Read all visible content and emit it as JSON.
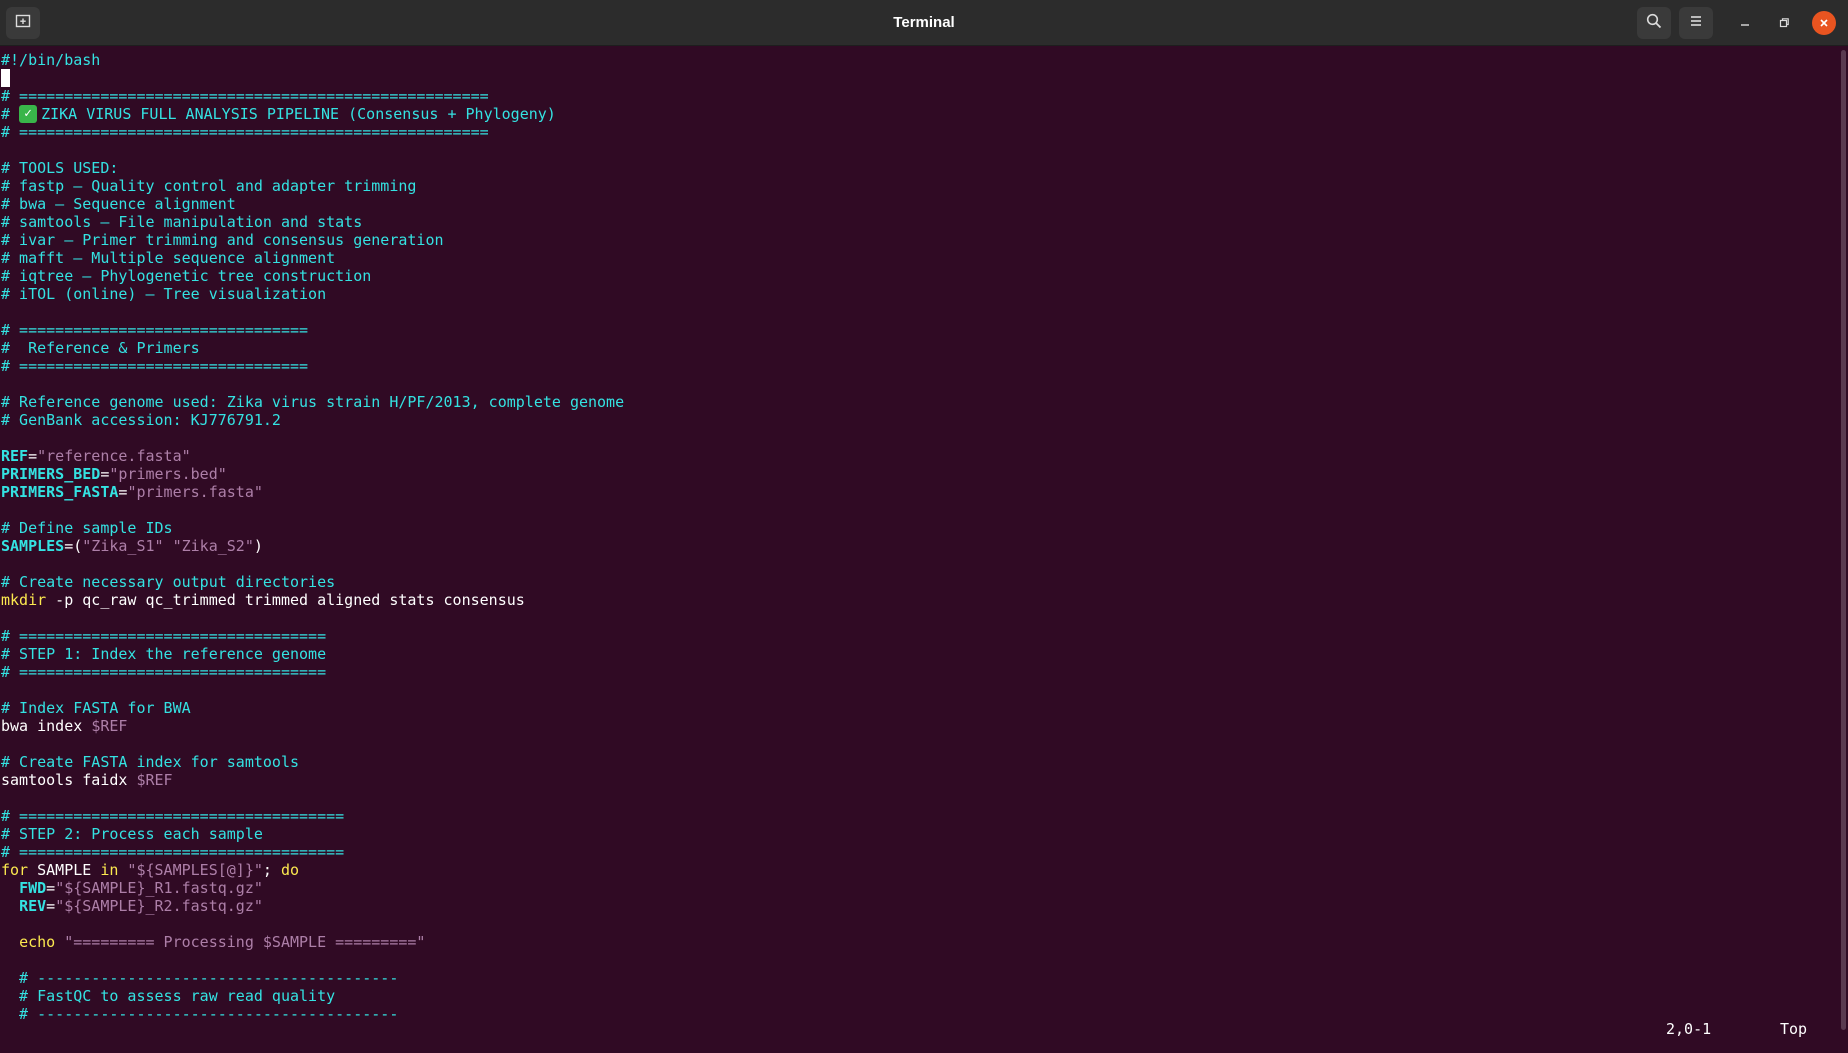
{
  "window": {
    "title": "Terminal",
    "icons": {
      "new_tab": "new-tab-icon",
      "search": "search-icon",
      "menu": "hamburger-menu-icon",
      "minimize": "minimize-icon",
      "maximize": "maximize-icon",
      "close": "close-icon"
    }
  },
  "colors": {
    "background": "#300a24",
    "titlebar": "#2c2c2c",
    "comment": "#34e2e2",
    "string": "#ad7fa8",
    "keyword": "#fce94f",
    "text": "#ffffff",
    "close_button": "#e95420"
  },
  "editor": {
    "lines": [
      [
        {
          "t": "#!/bin/bash",
          "c": "comment"
        }
      ],
      [
        {
          "t": "",
          "c": "cursor"
        }
      ],
      [
        {
          "t": "# ====================================================",
          "c": "comment"
        }
      ],
      [
        {
          "t": "# ",
          "c": "comment"
        },
        {
          "t": "✓",
          "c": "check"
        },
        {
          "t": "ZIKA VIRUS FULL ANALYSIS PIPELINE (Consensus + Phylogeny)",
          "c": "comment"
        }
      ],
      [
        {
          "t": "# ====================================================",
          "c": "comment"
        }
      ],
      [],
      [
        {
          "t": "# TOOLS USED:",
          "c": "comment"
        }
      ],
      [
        {
          "t": "# fastp – Quality control and adapter trimming",
          "c": "comment"
        }
      ],
      [
        {
          "t": "# bwa – Sequence alignment",
          "c": "comment"
        }
      ],
      [
        {
          "t": "# samtools – File manipulation and stats",
          "c": "comment"
        }
      ],
      [
        {
          "t": "# ivar – Primer trimming and consensus generation",
          "c": "comment"
        }
      ],
      [
        {
          "t": "# mafft – Multiple sequence alignment",
          "c": "comment"
        }
      ],
      [
        {
          "t": "# iqtree – Phylogenetic tree construction",
          "c": "comment"
        }
      ],
      [
        {
          "t": "# iTOL (online) – Tree visualization",
          "c": "comment"
        }
      ],
      [],
      [
        {
          "t": "# ================================",
          "c": "comment"
        }
      ],
      [
        {
          "t": "#  Reference & Primers",
          "c": "comment"
        }
      ],
      [
        {
          "t": "# ================================",
          "c": "comment"
        }
      ],
      [],
      [
        {
          "t": "# Reference genome used: Zika virus strain H/PF/2013, complete genome",
          "c": "comment"
        }
      ],
      [
        {
          "t": "# GenBank accession: KJ776791.2",
          "c": "comment"
        }
      ],
      [],
      [
        {
          "t": "REF",
          "c": "var"
        },
        {
          "t": "=",
          "c": "plain"
        },
        {
          "t": "\"reference.fasta\"",
          "c": "str"
        }
      ],
      [
        {
          "t": "PRIMERS_BED",
          "c": "var"
        },
        {
          "t": "=",
          "c": "plain"
        },
        {
          "t": "\"primers.bed\"",
          "c": "str"
        }
      ],
      [
        {
          "t": "PRIMERS_FASTA",
          "c": "var"
        },
        {
          "t": "=",
          "c": "plain"
        },
        {
          "t": "\"primers.fasta\"",
          "c": "str"
        }
      ],
      [],
      [
        {
          "t": "# Define sample IDs",
          "c": "comment"
        }
      ],
      [
        {
          "t": "SAMPLES",
          "c": "var"
        },
        {
          "t": "=(",
          "c": "plain"
        },
        {
          "t": "\"Zika_S1\" \"Zika_S2\"",
          "c": "str"
        },
        {
          "t": ")",
          "c": "plain"
        }
      ],
      [],
      [
        {
          "t": "# Create necessary output directories",
          "c": "comment"
        }
      ],
      [
        {
          "t": "mkdir",
          "c": "kw"
        },
        {
          "t": " -p qc_raw qc_trimmed trimmed aligned stats consensus",
          "c": "plain"
        }
      ],
      [],
      [
        {
          "t": "# ==================================",
          "c": "comment"
        }
      ],
      [
        {
          "t": "# STEP 1: Index the reference genome",
          "c": "comment"
        }
      ],
      [
        {
          "t": "# ==================================",
          "c": "comment"
        }
      ],
      [],
      [
        {
          "t": "# Index FASTA for BWA",
          "c": "comment"
        }
      ],
      [
        {
          "t": "bwa index ",
          "c": "plain"
        },
        {
          "t": "$REF",
          "c": "str"
        }
      ],
      [],
      [
        {
          "t": "# Create FASTA index for samtools",
          "c": "comment"
        }
      ],
      [
        {
          "t": "samtools faidx ",
          "c": "plain"
        },
        {
          "t": "$REF",
          "c": "str"
        }
      ],
      [],
      [
        {
          "t": "# ====================================",
          "c": "comment"
        }
      ],
      [
        {
          "t": "# STEP 2: Process each sample",
          "c": "comment"
        }
      ],
      [
        {
          "t": "# ====================================",
          "c": "comment"
        }
      ],
      [
        {
          "t": "for",
          "c": "kw"
        },
        {
          "t": " SAMPLE ",
          "c": "plain"
        },
        {
          "t": "in",
          "c": "kw"
        },
        {
          "t": " \"",
          "c": "str"
        },
        {
          "t": "${SAMPLES[@]}",
          "c": "str"
        },
        {
          "t": "\"",
          "c": "str"
        },
        {
          "t": "; ",
          "c": "plain"
        },
        {
          "t": "do",
          "c": "kw"
        }
      ],
      [
        {
          "t": "  ",
          "c": "plain"
        },
        {
          "t": "FWD",
          "c": "var"
        },
        {
          "t": "=",
          "c": "plain"
        },
        {
          "t": "\"${SAMPLE}_R1.fastq.gz\"",
          "c": "str"
        }
      ],
      [
        {
          "t": "  ",
          "c": "plain"
        },
        {
          "t": "REV",
          "c": "var"
        },
        {
          "t": "=",
          "c": "plain"
        },
        {
          "t": "\"${SAMPLE}_R2.fastq.gz\"",
          "c": "str"
        }
      ],
      [],
      [
        {
          "t": "  ",
          "c": "plain"
        },
        {
          "t": "echo",
          "c": "kw"
        },
        {
          "t": " \"========= Processing $SAMPLE =========\"",
          "c": "str"
        }
      ],
      [],
      [
        {
          "t": "  # ----------------------------------------",
          "c": "comment"
        }
      ],
      [
        {
          "t": "  # FastQC to assess raw read quality",
          "c": "comment"
        }
      ],
      [
        {
          "t": "  # ----------------------------------------",
          "c": "comment"
        }
      ]
    ]
  },
  "statusbar": {
    "position": "2,0-1",
    "scroll": "Top"
  }
}
